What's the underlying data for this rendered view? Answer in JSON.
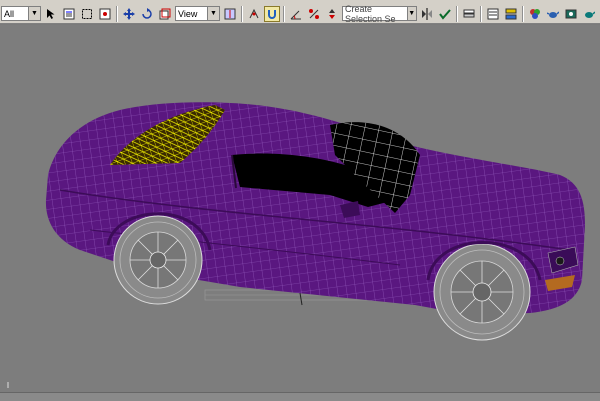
{
  "toolbar": {
    "selection_filter": "All",
    "reference_coordinate": "View",
    "named_selection_placeholder": "Create Selection Se"
  },
  "colors": {
    "car_body": "#5a1780",
    "wireframe": "#8a4fb0",
    "glass": "#000000",
    "selected_wire": "#ffff00",
    "viewport_bg": "#7d7d7d"
  }
}
